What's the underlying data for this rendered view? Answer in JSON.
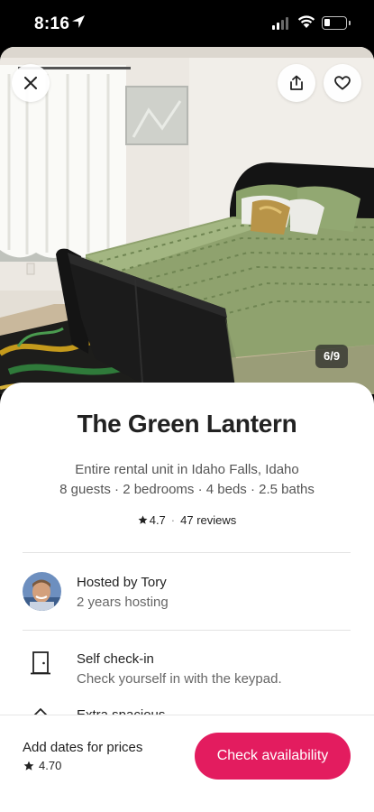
{
  "status_bar": {
    "time": "8:16"
  },
  "photo": {
    "counter": "6/9"
  },
  "listing": {
    "title": "The Green Lantern",
    "subtitle": "Entire rental unit in Idaho Falls, Idaho",
    "details": "8 guests · 2 bedrooms · 4 beds · 2.5 baths",
    "rating": "4.7",
    "rating_separator": "·",
    "reviews": "47 reviews"
  },
  "host": {
    "name": "Hosted by Tory",
    "years": "2 years hosting"
  },
  "amenities": [
    {
      "title": "Self check-in",
      "desc": "Check yourself in with the keypad.",
      "icon": "door-icon"
    },
    {
      "title": "Extra spacious",
      "icon": "home-icon"
    }
  ],
  "footer": {
    "label": "Add dates for prices",
    "rating": "4.70",
    "button": "Check availability"
  },
  "colors": {
    "accent": "#e31c5f",
    "text": "#222222",
    "muted": "#666666"
  }
}
